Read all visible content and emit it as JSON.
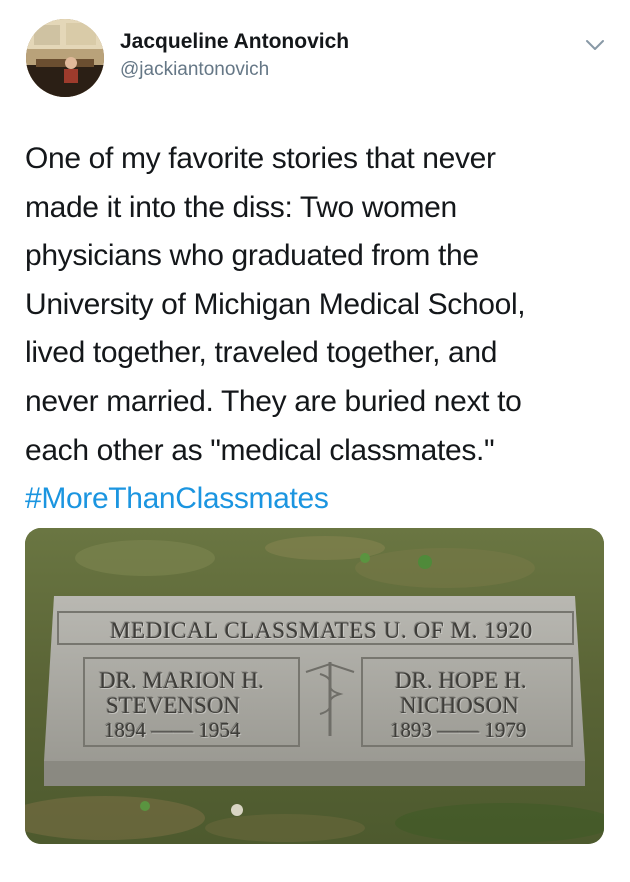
{
  "author": {
    "name": "Jacqueline Antonovich",
    "handle": "@jackiantonovich"
  },
  "icons": {
    "menu": "chevron-down-icon"
  },
  "tweet": {
    "lines": [
      "One of my favorite stories that never",
      "made it into the diss: Two women",
      "physicians who graduated from the",
      "University of Michigan Medical School,",
      "lived together, traveled together, and",
      "never married. They are buried next to",
      "each other as \"medical classmates.\""
    ],
    "hashtag": "#MoreThanClassmates"
  },
  "gravestone": {
    "header": "MEDICAL CLASSMATES U. OF M. 1920",
    "left": {
      "name_line1": "DR. MARION H.",
      "name_line2": "STEVENSON",
      "years": "1894 —— 1954"
    },
    "right": {
      "name_line1": "DR. HOPE H.",
      "name_line2": "NICHOSON",
      "years": "1893 —— 1979"
    }
  },
  "colors": {
    "link": "#1b95e0",
    "secondary_text": "#657786",
    "primary_text": "#14171a"
  }
}
